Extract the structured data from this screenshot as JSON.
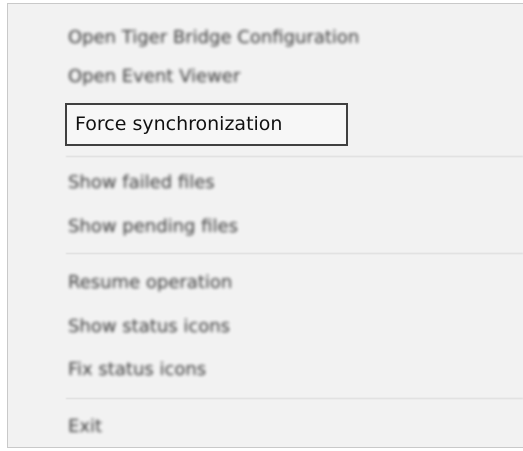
{
  "menu": {
    "items": [
      {
        "label": "Open Tiger Bridge Configuration"
      },
      {
        "label": "Open Event Viewer"
      },
      {
        "label": "Force synchronization"
      },
      {
        "label": "Show failed files"
      },
      {
        "label": "Show pending files"
      },
      {
        "label": "Resume operation"
      },
      {
        "label": "Show status icons"
      },
      {
        "label": "Fix status icons"
      },
      {
        "label": "Exit"
      }
    ]
  }
}
